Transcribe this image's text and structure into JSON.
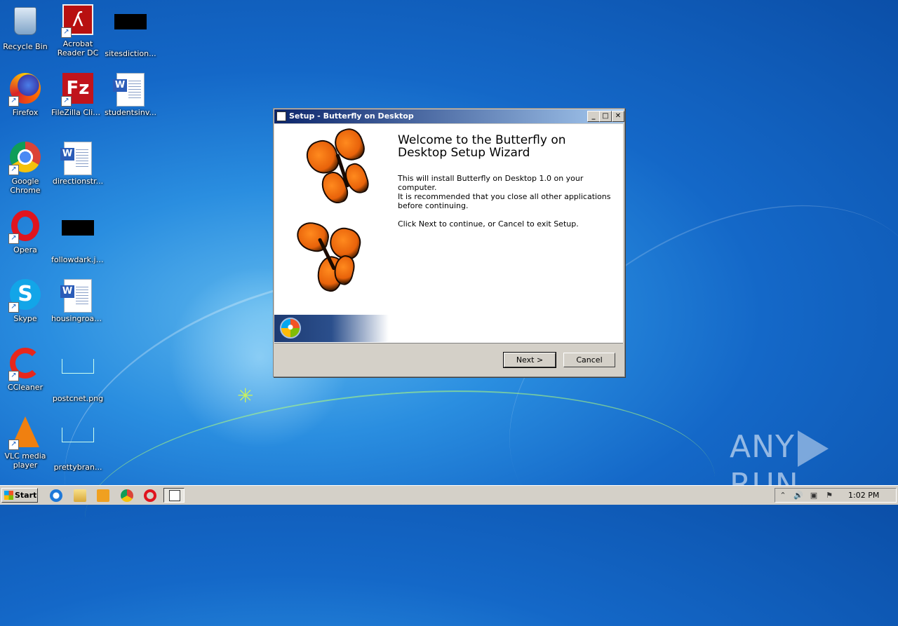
{
  "desktop": {
    "icons": [
      {
        "label": "Recycle Bin",
        "icon": "recycle-bin-icon"
      },
      {
        "label": "Acrobat Reader DC",
        "icon": "acrobat-reader-icon"
      },
      {
        "label": "sitesdiction...",
        "icon": "image-file-icon"
      },
      {
        "label": "Firefox",
        "icon": "firefox-icon"
      },
      {
        "label": "FileZilla Client",
        "icon": "filezilla-icon"
      },
      {
        "label": "studentsinv...",
        "icon": "word-document-icon"
      },
      {
        "label": "Google Chrome",
        "icon": "chrome-icon"
      },
      {
        "label": "directionstr...",
        "icon": "word-document-icon"
      },
      {
        "label": "Opera",
        "icon": "opera-icon"
      },
      {
        "label": "followdark.jpg",
        "icon": "image-file-icon"
      },
      {
        "label": "Skype",
        "icon": "skype-icon"
      },
      {
        "label": "housingroad...",
        "icon": "word-document-icon"
      },
      {
        "label": "CCleaner",
        "icon": "ccleaner-icon"
      },
      {
        "label": "postcnet.png",
        "icon": "image-file-icon"
      },
      {
        "label": "VLC media player",
        "icon": "vlc-icon"
      },
      {
        "label": "prettybran...",
        "icon": "image-file-icon"
      }
    ]
  },
  "dialog": {
    "title": "Setup - Butterfly on Desktop",
    "heading": "Welcome to the Butterfly on Desktop Setup Wizard",
    "paragraphs": [
      "This will install Butterfly on Desktop 1.0 on your computer.",
      "It is recommended that you close all other applications before continuing.",
      "Click Next to continue, or Cancel to exit Setup."
    ],
    "next_label": "Next >",
    "cancel_label": "Cancel"
  },
  "taskbar": {
    "start_label": "Start",
    "quicklaunch": [
      "internet-explorer-icon",
      "explorer-folder-icon",
      "media-player-icon",
      "chrome-icon",
      "opera-icon",
      "setup-task-icon"
    ],
    "clock": "1:02 PM"
  },
  "watermark": {
    "left": "ANY",
    "right": "RUN"
  },
  "colors": {
    "title_gradient_start": "#0a246a",
    "title_gradient_end": "#a6caf0",
    "dialog_face": "#d4d0c8",
    "desktop_blue": "#1468c8"
  }
}
